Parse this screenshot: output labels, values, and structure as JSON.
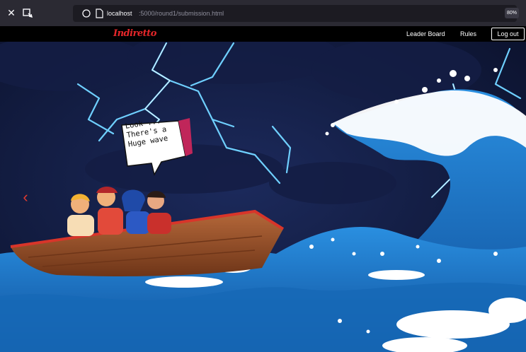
{
  "browser": {
    "url_host": "localhost",
    "url_path": ":5000/round1/submission.html",
    "zoom": "80%",
    "icons": [
      "close-icon",
      "extension-icon",
      "shield-icon",
      "page-icon"
    ]
  },
  "nav": {
    "brand": "Indiretto",
    "links": [
      {
        "label": "Leader Board"
      },
      {
        "label": "Rules"
      }
    ],
    "logout_label": "Log out"
  },
  "hero": {
    "speech": "Look ...\nThere's a\nHuge wave",
    "prev_icon": "chevron-left-icon"
  },
  "colors": {
    "chrome_bg": "#2b2a33",
    "nav_bg": "#000000",
    "brand_red": "#e5262a",
    "sky": "#0d1430",
    "wave_blue": "#1f7fd0",
    "boat_wood": "#8b4a25"
  }
}
